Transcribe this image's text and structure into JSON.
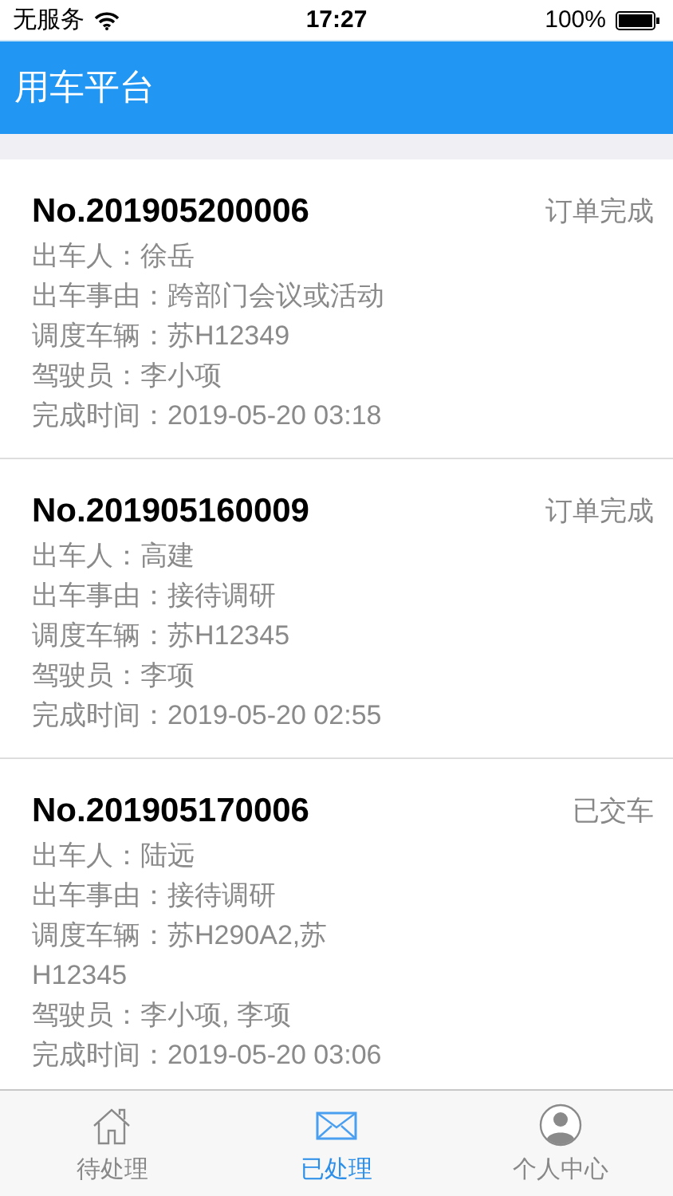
{
  "status_bar": {
    "carrier": "无服务",
    "time": "17:27",
    "battery": "100%"
  },
  "header": {
    "title": "用车平台"
  },
  "orders": [
    {
      "number": "No.201905200006",
      "status": "订单完成",
      "lines": [
        "出车人：徐岳",
        "出车事由：跨部门会议或活动",
        "调度车辆：苏H12349",
        "驾驶员：李小项",
        "完成时间：2019-05-20 03:18"
      ]
    },
    {
      "number": "No.201905160009",
      "status": "订单完成",
      "lines": [
        "出车人：高建",
        "出车事由：接待调研",
        "调度车辆：苏H12345",
        "驾驶员：李项",
        "完成时间：2019-05-20 02:55"
      ]
    },
    {
      "number": "No.201905170006",
      "status": "已交车",
      "lines": [
        "出车人：陆远",
        "出车事由：接待调研",
        "调度车辆：苏H290A2,苏H12345",
        "驾驶员：李小项, 李项",
        "完成时间：2019-05-20 03:06"
      ]
    }
  ],
  "tabs": [
    {
      "label": "待处理",
      "kind": "home",
      "selected": false
    },
    {
      "label": "已处理",
      "kind": "mail",
      "selected": true
    },
    {
      "label": "个人中心",
      "kind": "person",
      "selected": false
    }
  ]
}
